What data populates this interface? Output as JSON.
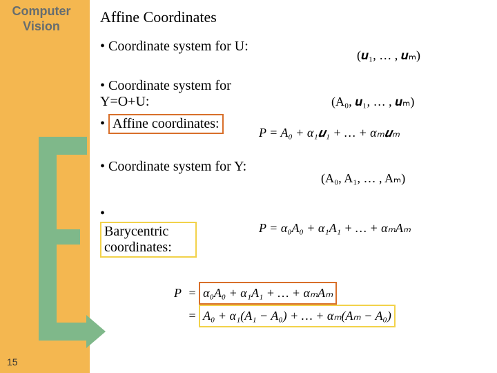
{
  "sidebar": {
    "title_line1": "Computer",
    "title_line2": "Vision"
  },
  "page_number": "15",
  "heading": "Affine Coordinates",
  "bullets": {
    "b1": {
      "text": "Coordinate system for U:",
      "formula": "(𝒖₁, … , 𝒖ₘ)"
    },
    "b2": {
      "text": "Coordinate system for  Y=O+U:",
      "formula": "(A₀, 𝒖₁, … , 𝒖ₘ)"
    },
    "b3": {
      "text": "Affine coordinates:",
      "formula": "P = A₀ + α₁𝒖₁ + … + αₘ𝒖ₘ"
    },
    "b4": {
      "text": "Coordinate system for Y:",
      "formula": "(A₀, A₁, … , Aₘ)"
    },
    "b5": {
      "text": "Barycentric coordinates:",
      "formula": "P = α₀A₀ + α₁A₁ + … + αₘAₘ"
    }
  },
  "eq_block": {
    "lhs": "P",
    "row1": "α₀A₀ + α₁A₁ + … + αₘAₘ",
    "row2": "A₀ + α₁(A₁ − A₀) + … + αₘ(Aₘ − A₀)"
  }
}
